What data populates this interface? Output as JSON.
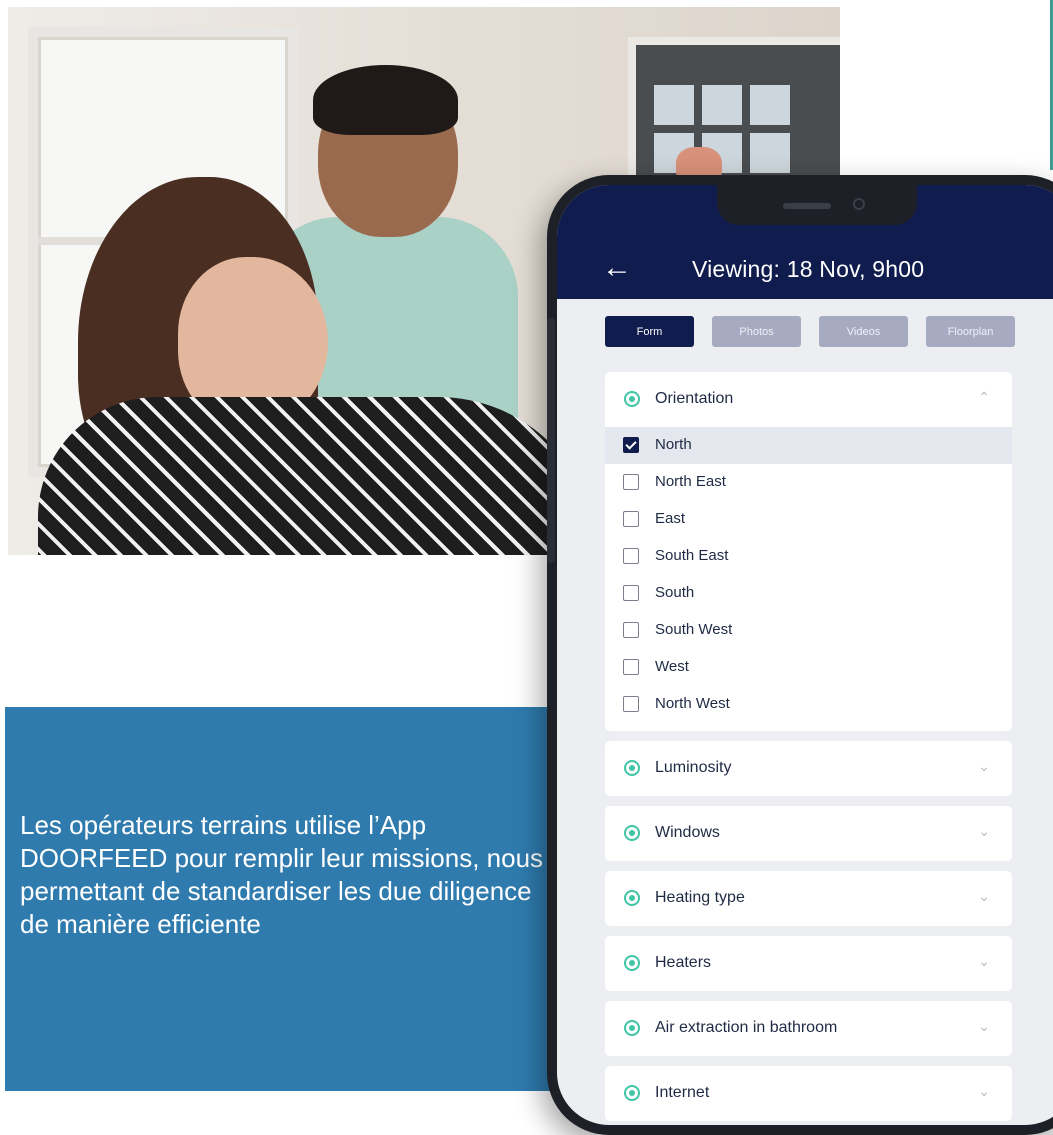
{
  "panel": {
    "text": "Les  opérateurs terrains utilise l’App DOORFEED pour remplir leur missions, nous permettant de standardiser les due diligence de manière efficiente"
  },
  "app": {
    "title": "Viewing: 18 Nov, 9h00",
    "back_icon": "←",
    "tabs": [
      {
        "label": "Form",
        "active": true
      },
      {
        "label": "Photos",
        "active": false
      },
      {
        "label": "Videos",
        "active": false
      },
      {
        "label": "Floorplan",
        "active": false
      }
    ],
    "sections": [
      {
        "label": "Orientation",
        "chevron": "⌃"
      },
      {
        "label": "Luminosity",
        "chevron": "⌄"
      },
      {
        "label": "Windows",
        "chevron": "⌄"
      },
      {
        "label": "Heating type",
        "chevron": "⌄"
      },
      {
        "label": "Heaters",
        "chevron": "⌄"
      },
      {
        "label": "Air extraction in bathroom",
        "chevron": "⌄"
      },
      {
        "label": "Internet",
        "chevron": "⌄"
      }
    ],
    "orientation_options": [
      {
        "label": "North",
        "checked": true
      },
      {
        "label": "North East",
        "checked": false
      },
      {
        "label": "East",
        "checked": false
      },
      {
        "label": "South East",
        "checked": false
      },
      {
        "label": "South",
        "checked": false
      },
      {
        "label": "South West",
        "checked": false
      },
      {
        "label": "West",
        "checked": false
      },
      {
        "label": "North West",
        "checked": false
      }
    ]
  },
  "colors": {
    "app_bar": "#0f1c4d",
    "panel": "#2f7bae",
    "accent_radio": "#3fc5a6"
  }
}
